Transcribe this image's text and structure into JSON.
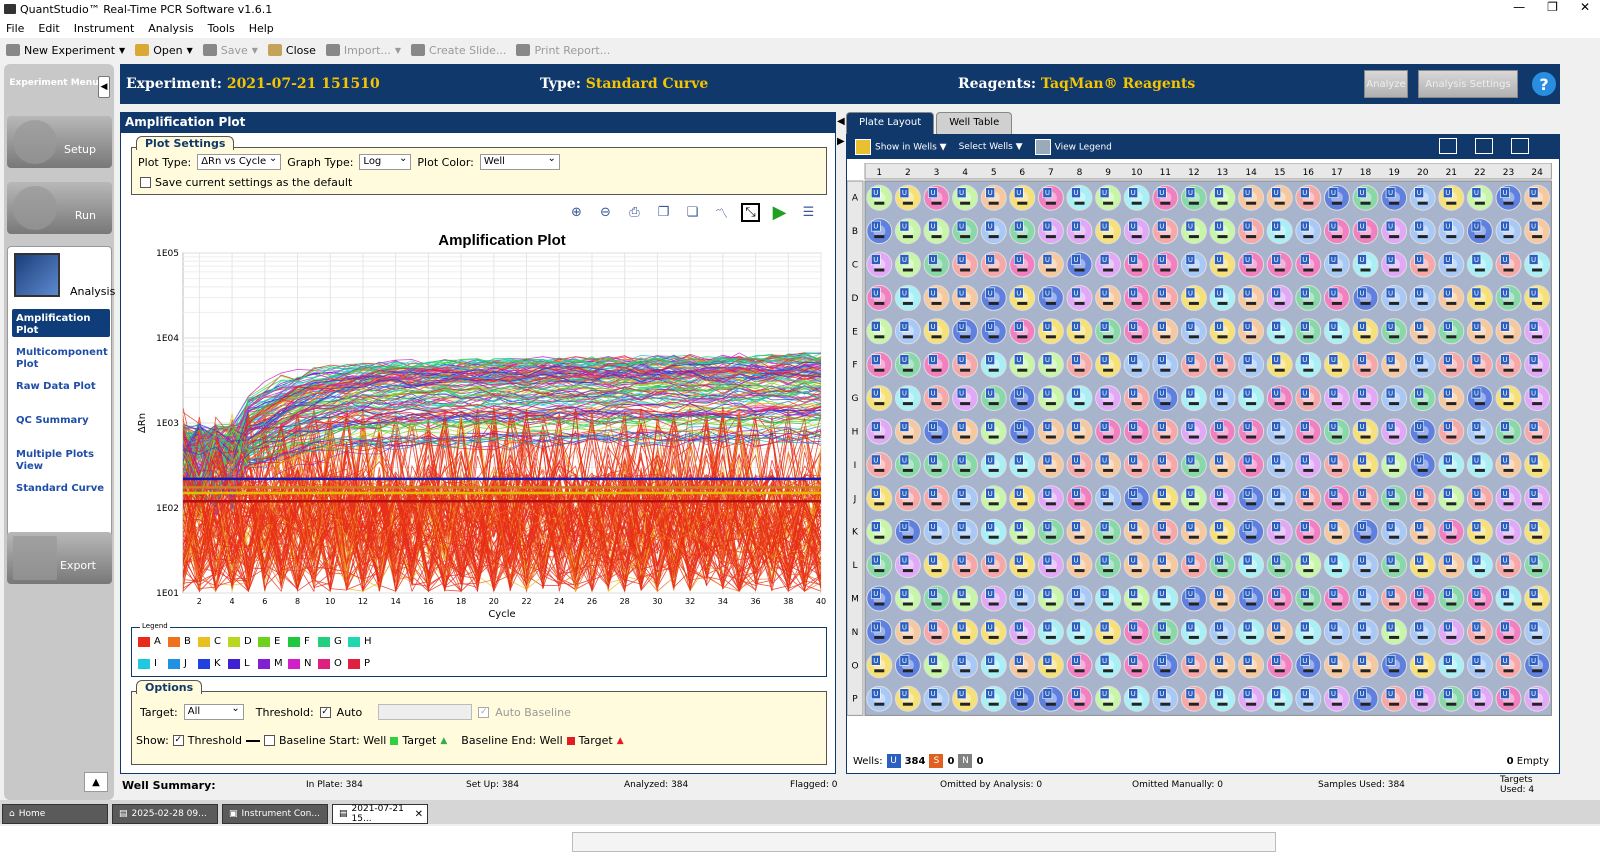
{
  "window": {
    "title": "QuantStudio™ Real-Time PCR Software v1.6.1",
    "minimize": "—",
    "restore": "❐",
    "close": "✕"
  },
  "menu": [
    "File",
    "Edit",
    "Instrument",
    "Analysis",
    "Tools",
    "Help"
  ],
  "toolbar": {
    "new_experiment": "New Experiment",
    "open": "Open",
    "save": "Save",
    "close": "Close",
    "import": "Import...",
    "create_slide": "Create Slide...",
    "print_report": "Print Report..."
  },
  "sidebar": {
    "title": "Experiment Menu",
    "setup": "Setup",
    "run": "Run",
    "analysis": "Analysis",
    "export": "Export",
    "nav": [
      "Amplification Plot",
      "Multicomponent Plot",
      "Raw Data Plot",
      "QC Summary",
      "Multiple Plots View",
      "Standard Curve"
    ]
  },
  "header": {
    "experiment_label": "Experiment:",
    "experiment_value": "2021-07-21 151510",
    "type_label": "Type:",
    "type_value": "Standard Curve",
    "reagents_label": "Reagents:",
    "reagents_value": "TaqMan® Reagents",
    "analyze": "Analyze",
    "analysis_settings": "Analysis Settings",
    "help": "?"
  },
  "amp": {
    "panel_title": "Amplification Plot",
    "plot_settings": "Plot Settings",
    "plot_type_label": "Plot Type:",
    "plot_type_value": "ΔRn vs Cycle",
    "graph_type_label": "Graph Type:",
    "graph_type_value": "Log",
    "plot_color_label": "Plot Color:",
    "plot_color_value": "Well",
    "save_default": "Save current settings as the default",
    "legend_title": "Legend",
    "options": "Options",
    "target_label": "Target:",
    "target_value": "All",
    "threshold_label": "Threshold:",
    "auto": "Auto",
    "auto_baseline": "Auto Baseline",
    "show_label": "Show:",
    "show_threshold": "Threshold",
    "baseline_start": "Baseline Start: Well",
    "target_text": "Target",
    "baseline_end": "Baseline End: Well",
    "target_text2": "Target"
  },
  "chart_data": {
    "type": "line",
    "title": "Amplification Plot",
    "xlabel": "Cycle",
    "ylabel": "ΔRn",
    "x_ticks": [
      2,
      4,
      6,
      8,
      10,
      12,
      14,
      16,
      18,
      20,
      22,
      24,
      26,
      28,
      30,
      32,
      34,
      36,
      38,
      40
    ],
    "y_ticks": [
      "1E01",
      "1E02",
      "1E03",
      "1E04",
      "1E05"
    ],
    "y_scale": "log",
    "xlim": [
      1,
      40
    ],
    "ylim": [
      10,
      100000
    ],
    "grid": true,
    "thresholds": [
      {
        "value": 220,
        "color": "#1a1ab0"
      },
      {
        "value": 175,
        "color": "#d08020"
      },
      {
        "value": 150,
        "color": "#e0c000"
      },
      {
        "value": 120,
        "color": "#b01010"
      }
    ],
    "series_groups": [
      {
        "name": "A",
        "color": "#e82a1a"
      },
      {
        "name": "B",
        "color": "#f07020"
      },
      {
        "name": "C",
        "color": "#e8c020"
      },
      {
        "name": "D",
        "color": "#b8d820"
      },
      {
        "name": "E",
        "color": "#70d020"
      },
      {
        "name": "F",
        "color": "#20c840"
      },
      {
        "name": "G",
        "color": "#20d080"
      },
      {
        "name": "H",
        "color": "#20d8b0"
      },
      {
        "name": "I",
        "color": "#20c8e0"
      },
      {
        "name": "J",
        "color": "#2090e0"
      },
      {
        "name": "K",
        "color": "#2040e0"
      },
      {
        "name": "L",
        "color": "#4020d0"
      },
      {
        "name": "M",
        "color": "#8020d0"
      },
      {
        "name": "N",
        "color": "#d020c8"
      },
      {
        "name": "O",
        "color": "#e02080"
      },
      {
        "name": "P",
        "color": "#e02040"
      }
    ]
  },
  "plate": {
    "tab_layout": "Plate Layout",
    "tab_table": "Well Table",
    "show_in_wells": "Show in Wells ▼",
    "select_wells": "Select Wells ▼",
    "view_legend": "View Legend",
    "columns": [
      "1",
      "2",
      "3",
      "4",
      "5",
      "6",
      "7",
      "8",
      "9",
      "10",
      "11",
      "12",
      "13",
      "14",
      "15",
      "16",
      "17",
      "18",
      "19",
      "20",
      "21",
      "22",
      "23",
      "24"
    ],
    "rows": [
      "A",
      "B",
      "C",
      "D",
      "E",
      "F",
      "G",
      "H",
      "I",
      "J",
      "K",
      "L",
      "M",
      "N",
      "O",
      "P"
    ],
    "well_letter": "U",
    "wells_label": "Wells:",
    "u_badge": "U",
    "u_count": "384",
    "s_badge": "S",
    "s_count": "0",
    "n_badge": "N",
    "n_count": "0",
    "empty_count": "0",
    "empty_label": "Empty"
  },
  "status": {
    "well_summary": "Well Summary:",
    "in_plate": "In Plate: 384",
    "set_up": "Set Up: 384",
    "analyzed": "Analyzed: 384",
    "flagged": "Flagged: 0",
    "omitted_analysis": "Omitted by Analysis: 0",
    "omitted_manually": "Omitted Manually: 0",
    "samples_used": "Samples Used: 384",
    "targets_used": "Targets Used: 4"
  },
  "tabs": [
    {
      "label": "Home"
    },
    {
      "label": "2025-02-28 09..."
    },
    {
      "label": "Instrument Con..."
    },
    {
      "label": "2021-07-21 15..."
    }
  ]
}
